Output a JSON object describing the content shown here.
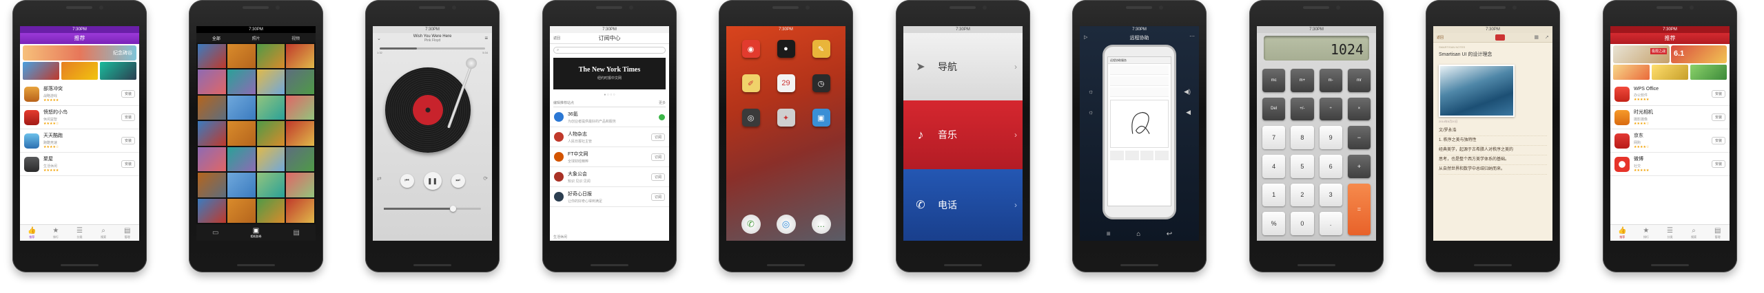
{
  "status_time": "7:30PM",
  "screen1": {
    "header": "推荐",
    "banner": "纪念碑谷",
    "apps": [
      {
        "name": "部落冲突",
        "sub": "战略游戏",
        "btn": "安装"
      },
      {
        "name": "愤怒的小鸟",
        "sub": "休闲益智",
        "btn": "安装"
      },
      {
        "name": "天天酷跑",
        "sub": "跑酷竞速",
        "btn": "安装"
      },
      {
        "name": "聚屋",
        "sub": "生活休闲",
        "btn": "安装"
      }
    ],
    "tabs": [
      "推荐",
      "排行",
      "分类",
      "搜索",
      "管理"
    ]
  },
  "screen2": {
    "tabs": [
      "全部",
      "照片",
      "视频"
    ],
    "bottom": [
      "",
      "相机胶卷",
      ""
    ]
  },
  "screen3": {
    "title": "Wish You Were Here",
    "artist": "Pink Floyd",
    "time_left": "1:32",
    "time_right": "5:34"
  },
  "screen4": {
    "header": "订阅中心",
    "back": "返回",
    "search_placeholder": "",
    "brand": "The New York Times",
    "brand_sub": "纽约时报中文网",
    "section": "编辑推荐站点",
    "section_more": "更多",
    "items": [
      {
        "name": "36氪",
        "sub": "为创业者提供最好的产品和服务",
        "btn": "已订"
      },
      {
        "name": "人物杂志",
        "sub": "人民日报社主管",
        "btn": "订阅"
      },
      {
        "name": "FT中文网",
        "sub": "全球财经精粹",
        "btn": "订阅"
      },
      {
        "name": "大象公会",
        "sub": "知识 见识 见闻",
        "btn": "订阅"
      },
      {
        "name": "好奇心日报",
        "sub": "让你的好奇心得到满足",
        "btn": "订阅"
      }
    ],
    "footer": "生活休闲"
  },
  "screen6": {
    "rows": [
      {
        "label": "导航",
        "color": "#e8e8e8",
        "text": "#333"
      },
      {
        "label": "音乐",
        "color": "#c51f29",
        "text": "#fff"
      },
      {
        "label": "电话",
        "color": "#1c4ea6",
        "text": "#fff"
      }
    ]
  },
  "screen7": {
    "header": "远程协助",
    "inner_title": "远程协助服务"
  },
  "screen8": {
    "display": "1024",
    "keys": [
      "mc",
      "m+",
      "m-",
      "mr",
      "Del",
      "+/-",
      "÷",
      "×",
      "7",
      "8",
      "9",
      "−",
      "4",
      "5",
      "6",
      "+",
      "1",
      "2",
      "3",
      "=",
      "%",
      "0",
      "."
    ]
  },
  "screen9": {
    "back": "返回",
    "breadcrumb": "SMARTISAN NOTES",
    "title": "Smartisan UI 的设计理念",
    "date": "2014年5月20日",
    "lines": [
      "文/罗永浩",
      "1. 秩序之美与独特性",
      "经典美学，起源于古希腊人对秩序之美的",
      "思考，也是整个西方美学体系的基础。",
      "从自然世界和数学中总结归纳而来。"
    ]
  },
  "screen10": {
    "header": "推荐",
    "banner_a": "极限之战",
    "banner_b": "6.1",
    "apps": [
      {
        "name": "WPS Office",
        "sub": "办公软件",
        "btn": "安装"
      },
      {
        "name": "时光相机",
        "sub": "摄影摄像",
        "btn": "安装"
      },
      {
        "name": "京东",
        "sub": "网购",
        "btn": "安装"
      },
      {
        "name": "微博",
        "sub": "社交",
        "btn": "安装"
      }
    ],
    "tabs": [
      "推荐",
      "排行",
      "分类",
      "搜索",
      "管理"
    ]
  }
}
